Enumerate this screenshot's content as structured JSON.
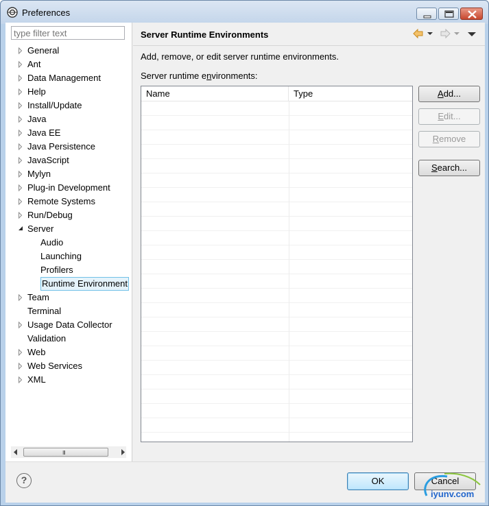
{
  "window": {
    "title": "Preferences"
  },
  "left": {
    "filter_placeholder": "type filter text",
    "tree": [
      {
        "label": "General",
        "expandable": true,
        "expanded": false,
        "level": 0
      },
      {
        "label": "Ant",
        "expandable": true,
        "expanded": false,
        "level": 0
      },
      {
        "label": "Data Management",
        "expandable": true,
        "expanded": false,
        "level": 0
      },
      {
        "label": "Help",
        "expandable": true,
        "expanded": false,
        "level": 0
      },
      {
        "label": "Install/Update",
        "expandable": true,
        "expanded": false,
        "level": 0
      },
      {
        "label": "Java",
        "expandable": true,
        "expanded": false,
        "level": 0
      },
      {
        "label": "Java EE",
        "expandable": true,
        "expanded": false,
        "level": 0
      },
      {
        "label": "Java Persistence",
        "expandable": true,
        "expanded": false,
        "level": 0
      },
      {
        "label": "JavaScript",
        "expandable": true,
        "expanded": false,
        "level": 0
      },
      {
        "label": "Mylyn",
        "expandable": true,
        "expanded": false,
        "level": 0
      },
      {
        "label": "Plug-in Development",
        "expandable": true,
        "expanded": false,
        "level": 0
      },
      {
        "label": "Remote Systems",
        "expandable": true,
        "expanded": false,
        "level": 0
      },
      {
        "label": "Run/Debug",
        "expandable": true,
        "expanded": false,
        "level": 0
      },
      {
        "label": "Server",
        "expandable": true,
        "expanded": true,
        "level": 0
      },
      {
        "label": "Audio",
        "expandable": false,
        "expanded": false,
        "level": 1
      },
      {
        "label": "Launching",
        "expandable": false,
        "expanded": false,
        "level": 1
      },
      {
        "label": "Profilers",
        "expandable": false,
        "expanded": false,
        "level": 1
      },
      {
        "label": "Runtime Environment",
        "expandable": false,
        "expanded": false,
        "level": 1,
        "selected": true
      },
      {
        "label": "Team",
        "expandable": true,
        "expanded": false,
        "level": 0
      },
      {
        "label": "Terminal",
        "expandable": false,
        "expanded": false,
        "level": 0
      },
      {
        "label": "Usage Data Collector",
        "expandable": true,
        "expanded": false,
        "level": 0
      },
      {
        "label": "Validation",
        "expandable": false,
        "expanded": false,
        "level": 0
      },
      {
        "label": "Web",
        "expandable": true,
        "expanded": false,
        "level": 0
      },
      {
        "label": "Web Services",
        "expandable": true,
        "expanded": false,
        "level": 0
      },
      {
        "label": "XML",
        "expandable": true,
        "expanded": false,
        "level": 0
      }
    ],
    "scrollbar_grip": "III"
  },
  "page": {
    "title": "Server Runtime Environments",
    "description": "Add, remove, or edit server runtime environments.",
    "list_label_pre": "Server runtime e",
    "list_label_mnemonic": "n",
    "list_label_post": "vironments:",
    "columns": [
      "Name",
      "Type"
    ],
    "rows": [],
    "buttons": {
      "add_mnemonic": "A",
      "add_rest": "dd...",
      "edit_mnemonic": "E",
      "edit_rest": "dit...",
      "remove_mnemonic": "R",
      "remove_rest": "emove",
      "search_mnemonic": "S",
      "search_rest": "earch..."
    }
  },
  "footer": {
    "help_glyph": "?",
    "ok_label": "OK",
    "cancel_label": "Cancel",
    "watermark_text": "iyunv.com"
  },
  "colors": {
    "selection_bg": "#e5f3fb",
    "selection_border": "#70c0e7",
    "nav_arrow": "#e8a33a"
  }
}
